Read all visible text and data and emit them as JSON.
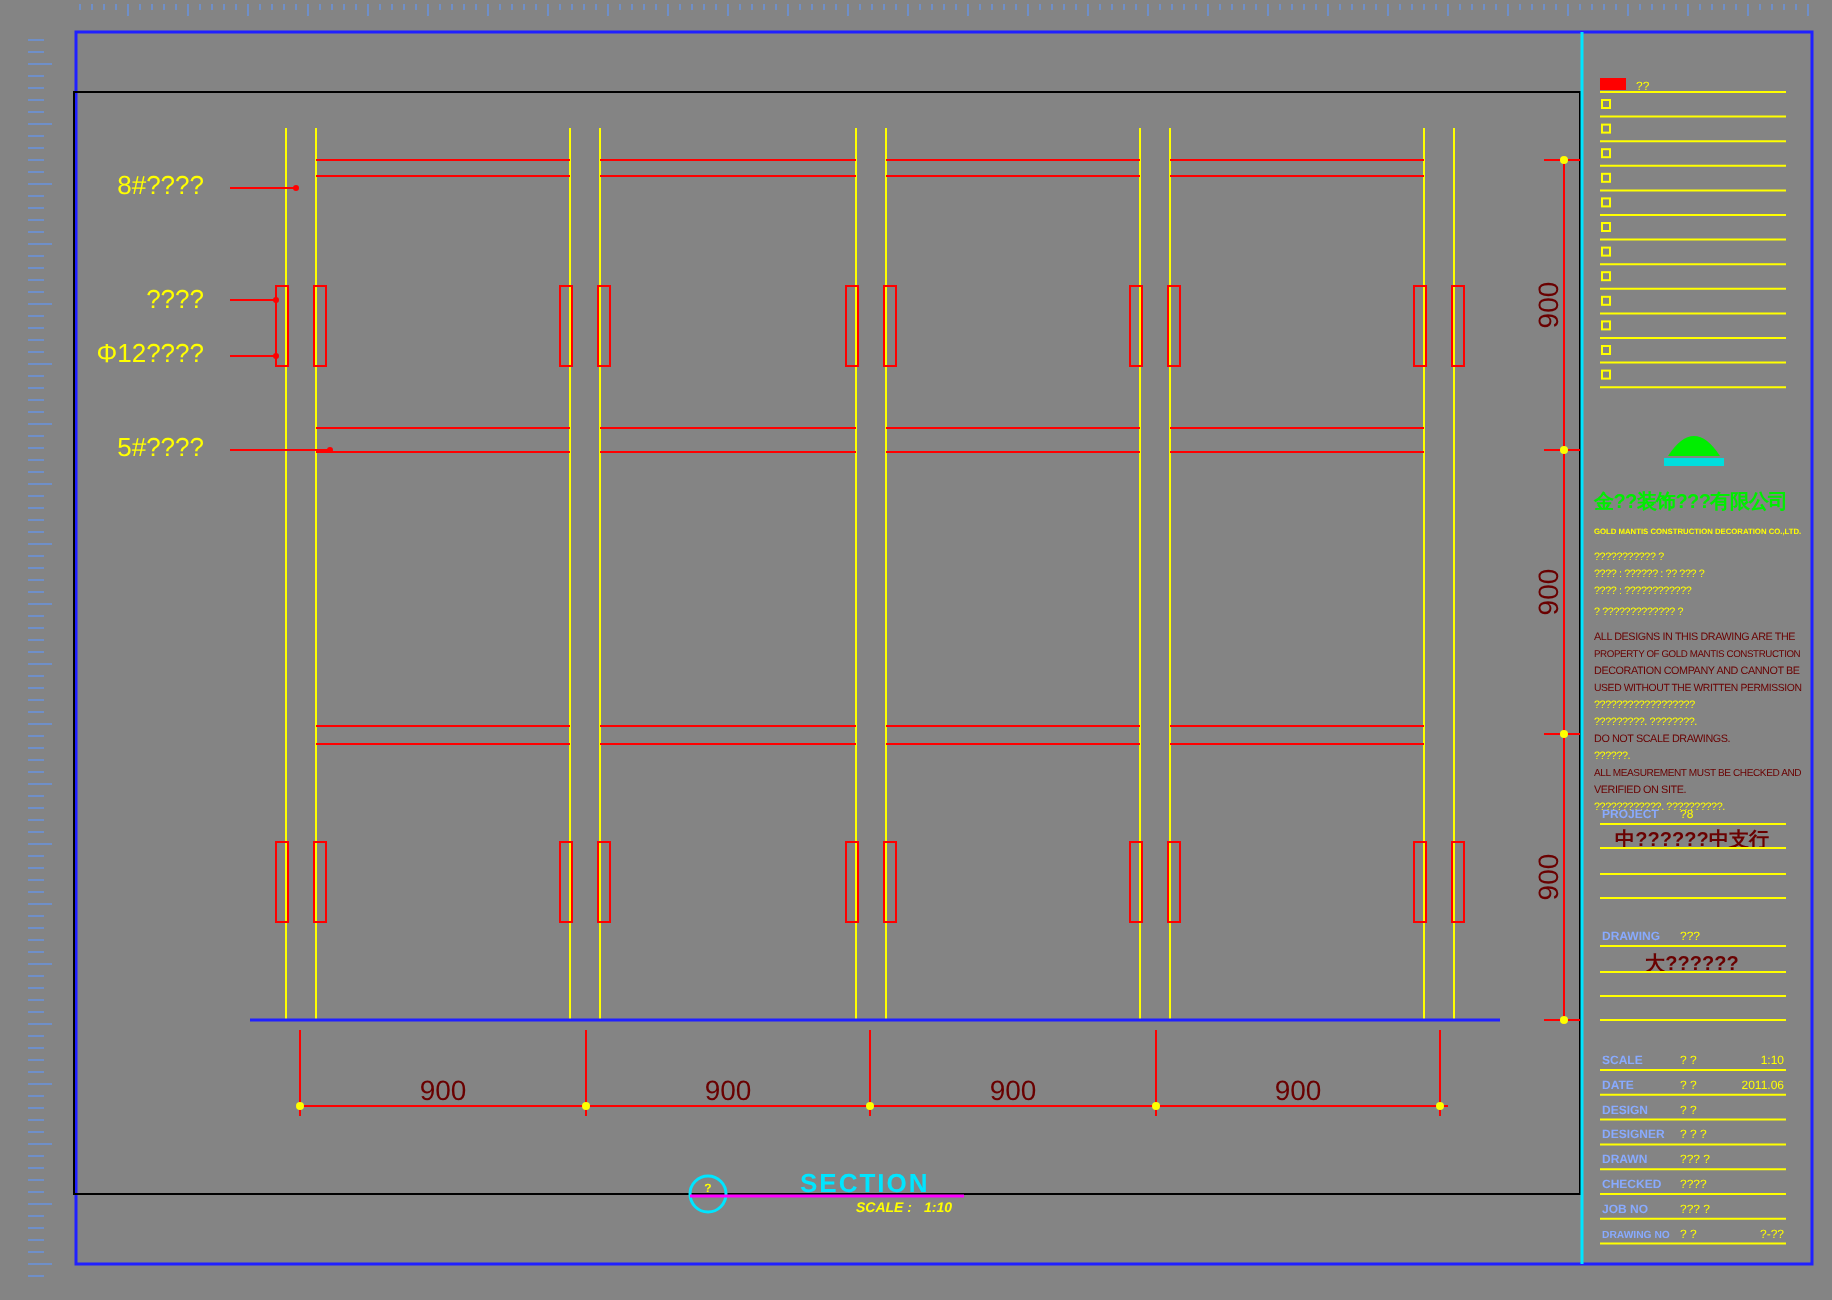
{
  "drawing": {
    "rail_labels": [
      {
        "text": "8#????"
      },
      {
        "text": "????"
      },
      {
        "text": "Φ12????"
      },
      {
        "text": "5#????"
      }
    ],
    "dimensions_vertical": [
      "900",
      "900",
      "900"
    ],
    "dimensions_horizontal": [
      "900",
      "900",
      "900",
      "900"
    ],
    "section": {
      "number": "?",
      "title": "SECTION",
      "scale_label": "SCALE :",
      "scale": "1:10"
    }
  },
  "title_block": {
    "header": "??",
    "company_cn": "金??装饰???有限公司",
    "company_en": "GOLD MANTIS CONSTRUCTION DECORATION CO.,LTD.",
    "notes": [
      {
        "kind": "info",
        "lines": [
          "??????????? ?",
          "???? : ?????? : ??    ??? ?",
          "???? : ????????????"
        ]
      },
      {
        "kind": "info",
        "lines": [
          "? ????????????? ?"
        ]
      },
      {
        "kind": "warning",
        "lines": [
          "ALL DESIGNS IN THIS DRAWING ARE THE",
          "PROPERTY OF GOLD MANTIS CONSTRUCTION",
          "DECORATION COMPANY AND CANNOT BE",
          "USED WITHOUT THE WRITTEN PERMISSION"
        ]
      },
      {
        "kind": "info",
        "lines": [
          "??????????????????",
          "?????????. ????????."
        ]
      },
      {
        "kind": "warning",
        "lines": [
          "DO NOT SCALE DRAWINGS."
        ]
      },
      {
        "kind": "info",
        "lines": [
          "??????."
        ]
      },
      {
        "kind": "warning",
        "lines": [
          "ALL MEASUREMENT MUST BE CHECKED AND",
          "VERIFIED ON SITE."
        ]
      },
      {
        "kind": "info",
        "lines": [
          "????????????. ??????????."
        ]
      }
    ],
    "project_label": "PROJECT",
    "project_no": "?8",
    "project_name": "中??????中支行",
    "drawing_label": "DRAWING",
    "drawing_no": "???",
    "drawing_name": "大??????",
    "info_rows": [
      {
        "label": "SCALE",
        "value": "? ?",
        "extra": "1:10"
      },
      {
        "label": "DATE",
        "value": "? ?",
        "extra": "2011.06"
      },
      {
        "label": "DESIGN",
        "value": "? ?"
      },
      {
        "label": "DESIGNER",
        "value": "? ? ?"
      },
      {
        "label": "DRAWN",
        "value": "??? ?"
      },
      {
        "label": "CHECKED",
        "value": "????"
      },
      {
        "label": "JOB NO",
        "value": "??? ?"
      },
      {
        "label": "DRAWING NO",
        "value": "? ?",
        "extra": "?-??"
      }
    ]
  }
}
